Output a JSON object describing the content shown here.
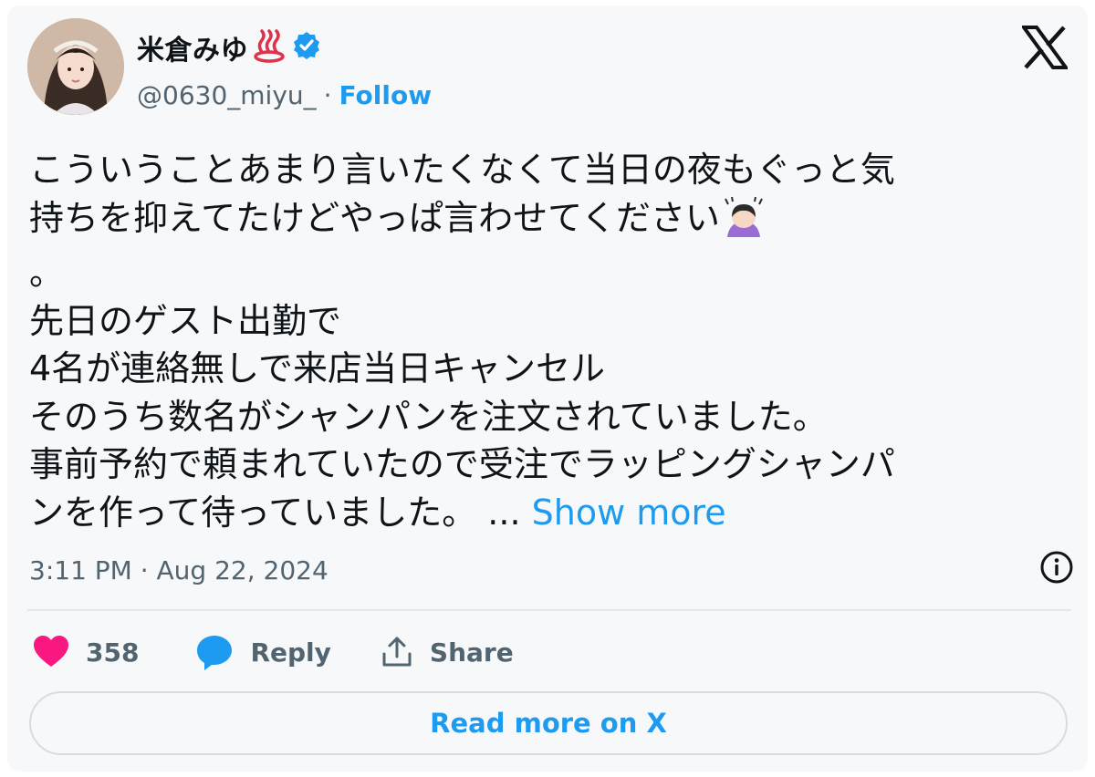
{
  "author": {
    "display_name": "米倉みゆ",
    "handle": "@0630_miyu_",
    "separator": "·",
    "follow_label": "Follow",
    "verified_color": "#1d9bf0"
  },
  "tweet": {
    "text": "こういうことあまり言いたくなくて当日の夜もぐっと気\n持ちを抑えてたけどやっぱ言わせてください",
    "text_after_emoji": "\n。\n先日のゲスト出勤で\n4名が連絡無しで来店当日キャンセル\nそのうち数名がシャンパンを注文されていました。\n事前予約で頼まれていたので受注でラッピングシャンパ\nンを作って待っていました。 ... ",
    "show_more_label": "Show more",
    "timestamp": "3:11 PM · Aug 22, 2024"
  },
  "actions": {
    "like_count": "358",
    "reply_label": "Reply",
    "share_label": "Share"
  },
  "read_more_label": "Read more on X",
  "colors": {
    "accent": "#1d9bf0",
    "like": "#f91880",
    "secondary_text": "#536471"
  },
  "icons": [
    "hot-springs-icon",
    "verified-badge-icon",
    "x-logo-icon",
    "person-bowing-icon",
    "info-icon",
    "heart-icon",
    "reply-bubble-icon",
    "share-icon"
  ]
}
